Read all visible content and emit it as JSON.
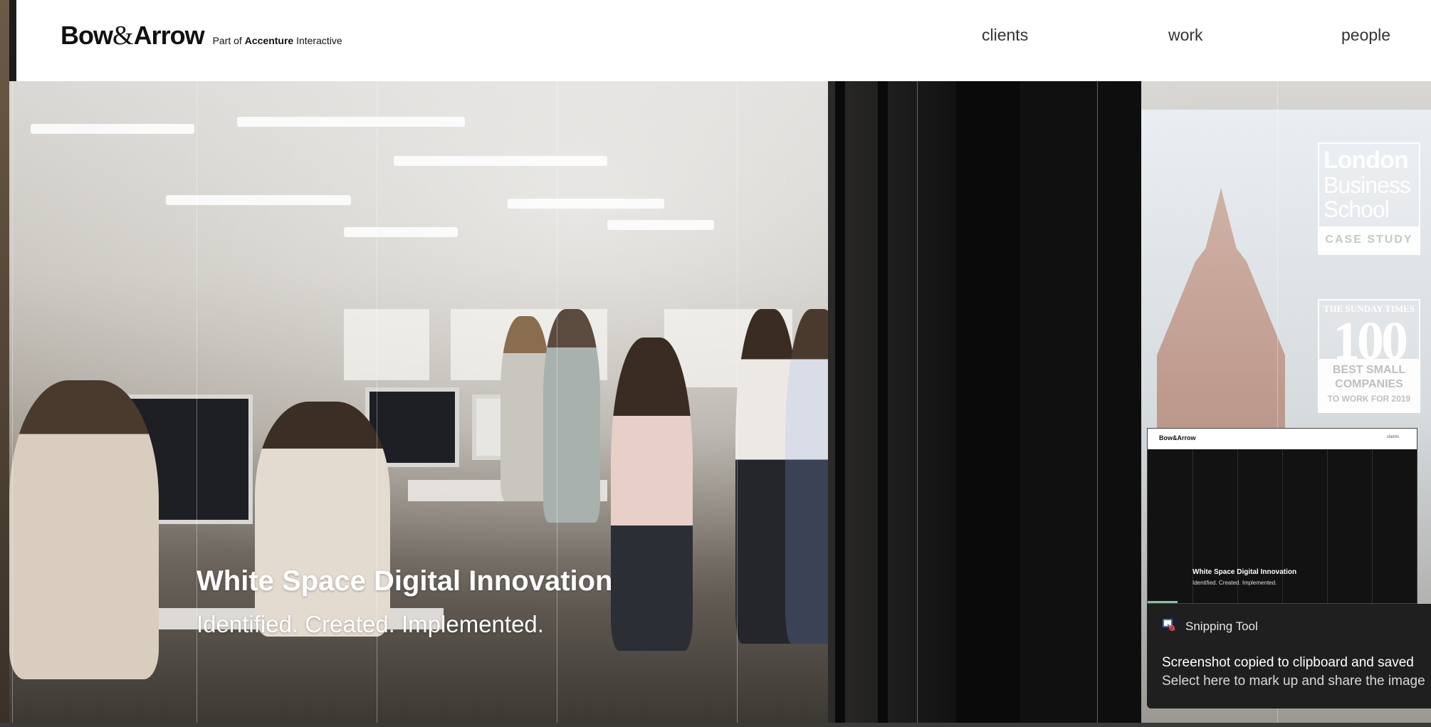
{
  "header": {
    "logo_left": "Bow",
    "logo_amp": "&",
    "logo_right": "Arrow",
    "logo_sub_prefix": "Part of ",
    "logo_sub_bold": "Accenture",
    "logo_sub_suffix": " Interactive",
    "nav": {
      "clients": "clients",
      "work": "work",
      "people": "people"
    }
  },
  "hero": {
    "title": "White Space Digital Innovation",
    "subtitle": "Identified. Created. Implemented."
  },
  "badges": {
    "lbs": {
      "line1": "London",
      "line2": "Business",
      "line3": "School",
      "caption": "CASE STUDY"
    },
    "sunday_times": {
      "masthead": "THE SUNDAY TIMES",
      "number": "100",
      "line1": "BEST SMALL",
      "line2": "COMPANIES",
      "line3": "TO WORK FOR 2019"
    }
  },
  "snip_thumbnail": {
    "logo": "Bow&Arrow",
    "nav": "clients",
    "title": "White Space Digital Innovation",
    "subtitle": "Identified. Created. Implemented."
  },
  "toast": {
    "app_name": "Snipping Tool",
    "icon": "snipping-tool-icon",
    "message": "Screenshot copied to clipboard and saved",
    "action": "Select here to mark up and share the image"
  },
  "colors": {
    "header_bg": "#ffffff",
    "toast_bg": "#1f1f1f",
    "hero_text": "#ffffff"
  }
}
